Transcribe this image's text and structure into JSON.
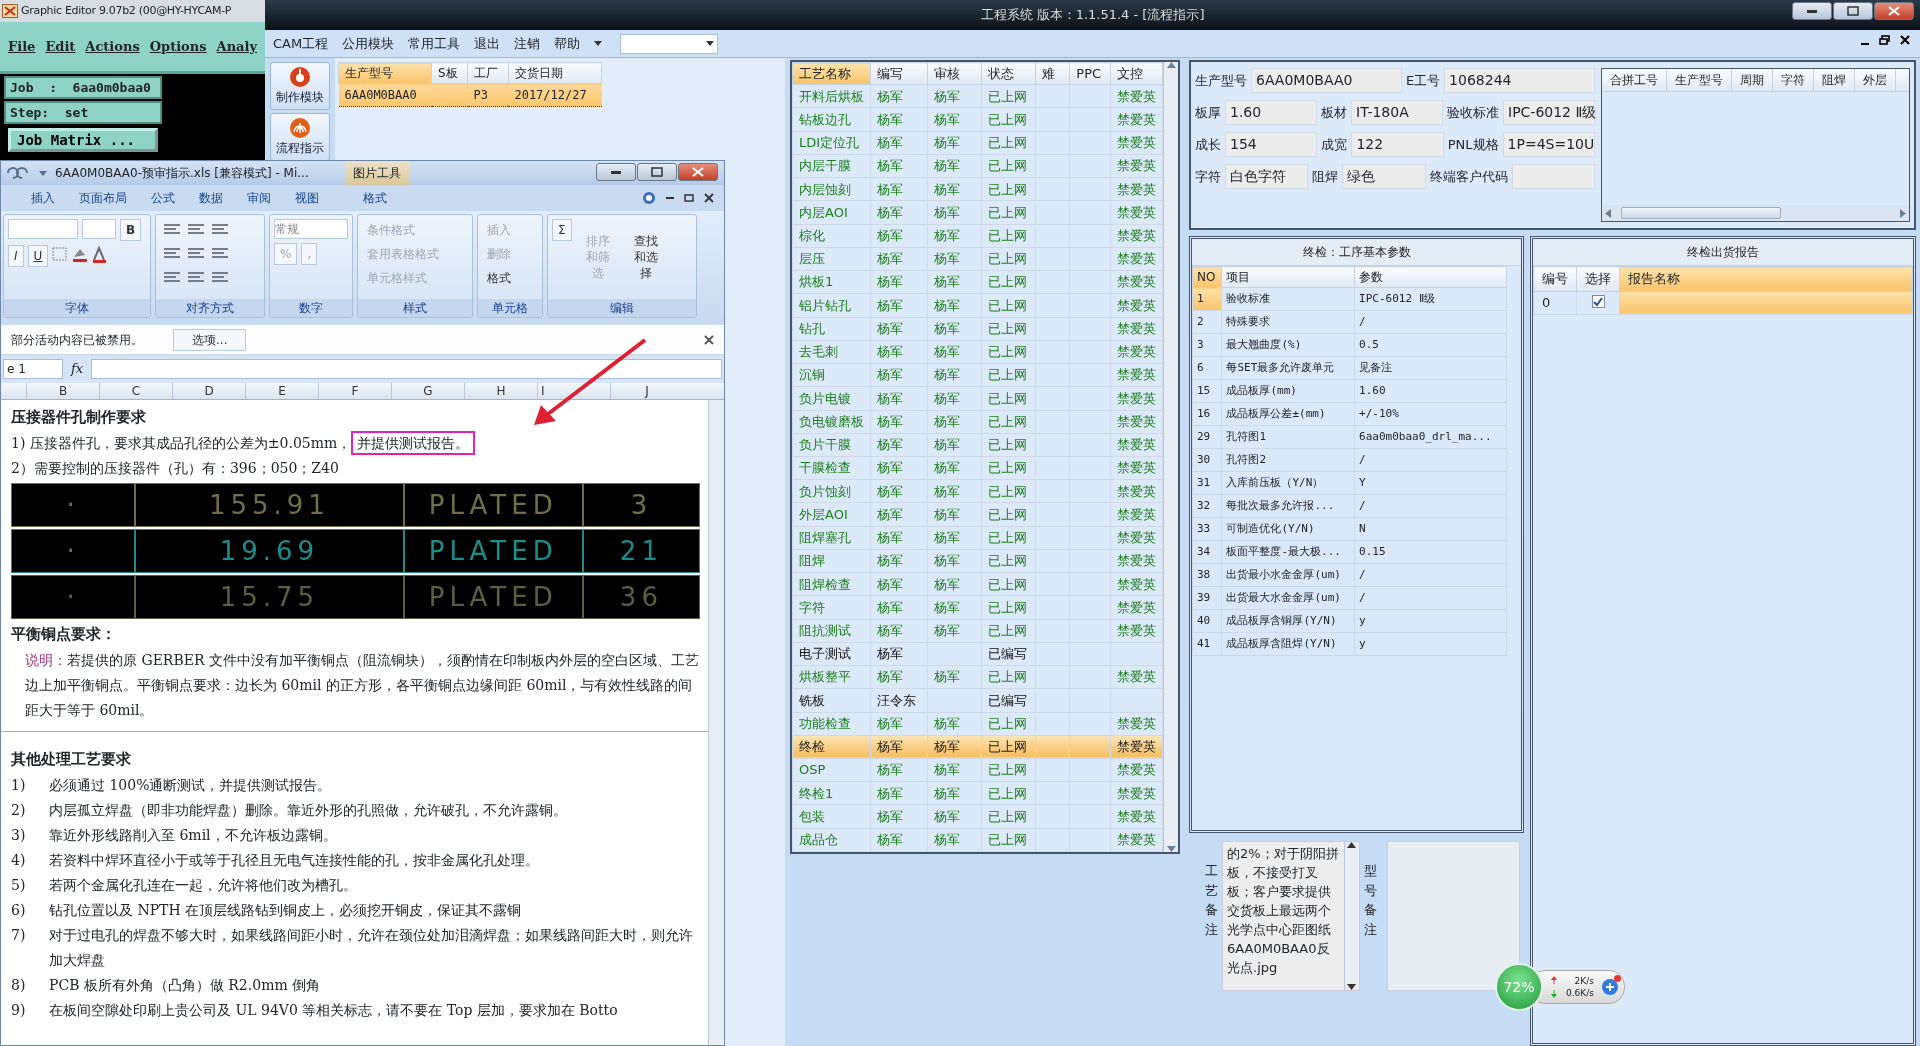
{
  "graphic_editor": {
    "title": "Graphic Editor 9.07b2 (00@HY-HYCAM-P",
    "menu": [
      "File",
      "Edit",
      "Actions",
      "Options",
      "Analy"
    ],
    "job": "Job  :  6aa0m0baa0",
    "step": "Step:  set",
    "button": "Job Matrix ..."
  },
  "cam": {
    "title": "工程系统   版本：1.1.51.4 - [流程指示]",
    "menu": [
      "CAM工程",
      "公用模块",
      "常用工具",
      "退出",
      "注销",
      "帮助"
    ],
    "tools": [
      "制作模块",
      "流程指示"
    ],
    "orders": {
      "columns": [
        "生产型号",
        "S板",
        "工厂",
        "交货日期"
      ],
      "rows": [
        {
          "cells": [
            "6AA0M0BAA0",
            "",
            "P3",
            "2017/12/27"
          ],
          "selected": true
        }
      ]
    },
    "process": {
      "columns": [
        "工艺名称",
        "编写",
        "审核",
        "状态",
        "难",
        "PPC",
        "文控"
      ],
      "rows": [
        {
          "name": "开料后烘板",
          "writer": "杨军",
          "reviewer": "杨军",
          "status": "已上网",
          "control": "禁爱英",
          "published": true,
          "selected": false
        },
        {
          "name": "钻板边孔",
          "writer": "杨军",
          "reviewer": "杨军",
          "status": "已上网",
          "control": "禁爱英",
          "published": true,
          "selected": false
        },
        {
          "name": "LDI定位孔",
          "writer": "杨军",
          "reviewer": "杨军",
          "status": "已上网",
          "control": "禁爱英",
          "published": true,
          "selected": false
        },
        {
          "name": "内层干膜",
          "writer": "杨军",
          "reviewer": "杨军",
          "status": "已上网",
          "control": "禁爱英",
          "published": true,
          "selected": false
        },
        {
          "name": "内层蚀刻",
          "writer": "杨军",
          "reviewer": "杨军",
          "status": "已上网",
          "control": "禁爱英",
          "published": true,
          "selected": false
        },
        {
          "name": "内层AOI",
          "writer": "杨军",
          "reviewer": "杨军",
          "status": "已上网",
          "control": "禁爱英",
          "published": true,
          "selected": false
        },
        {
          "name": "棕化",
          "writer": "杨军",
          "reviewer": "杨军",
          "status": "已上网",
          "control": "禁爱英",
          "published": true,
          "selected": false
        },
        {
          "name": "层压",
          "writer": "杨军",
          "reviewer": "杨军",
          "status": "已上网",
          "control": "禁爱英",
          "published": true,
          "selected": false
        },
        {
          "name": "烘板1",
          "writer": "杨军",
          "reviewer": "杨军",
          "status": "已上网",
          "control": "禁爱英",
          "published": true,
          "selected": false
        },
        {
          "name": "铝片钻孔",
          "writer": "杨军",
          "reviewer": "杨军",
          "status": "已上网",
          "control": "禁爱英",
          "published": true,
          "selected": false
        },
        {
          "name": "钻孔",
          "writer": "杨军",
          "reviewer": "杨军",
          "status": "已上网",
          "control": "禁爱英",
          "published": true,
          "selected": false
        },
        {
          "name": "去毛刺",
          "writer": "杨军",
          "reviewer": "杨军",
          "status": "已上网",
          "control": "禁爱英",
          "published": true,
          "selected": false
        },
        {
          "name": "沉铜",
          "writer": "杨军",
          "reviewer": "杨军",
          "status": "已上网",
          "control": "禁爱英",
          "published": true,
          "selected": false
        },
        {
          "name": "负片电镀",
          "writer": "杨军",
          "reviewer": "杨军",
          "status": "已上网",
          "control": "禁爱英",
          "published": true,
          "selected": false
        },
        {
          "name": "负电镀磨板",
          "writer": "杨军",
          "reviewer": "杨军",
          "status": "已上网",
          "control": "禁爱英",
          "published": true,
          "selected": false
        },
        {
          "name": "负片干膜",
          "writer": "杨军",
          "reviewer": "杨军",
          "status": "已上网",
          "control": "禁爱英",
          "published": true,
          "selected": false
        },
        {
          "name": "干膜检查",
          "writer": "杨军",
          "reviewer": "杨军",
          "status": "已上网",
          "control": "禁爱英",
          "published": true,
          "selected": false
        },
        {
          "name": "负片蚀刻",
          "writer": "杨军",
          "reviewer": "杨军",
          "status": "已上网",
          "control": "禁爱英",
          "published": true,
          "selected": false
        },
        {
          "name": "外层AOI",
          "writer": "杨军",
          "reviewer": "杨军",
          "status": "已上网",
          "control": "禁爱英",
          "published": true,
          "selected": false
        },
        {
          "name": "阻焊塞孔",
          "writer": "杨军",
          "reviewer": "杨军",
          "status": "已上网",
          "control": "禁爱英",
          "published": true,
          "selected": false
        },
        {
          "name": "阻焊",
          "writer": "杨军",
          "reviewer": "杨军",
          "status": "已上网",
          "control": "禁爱英",
          "published": true,
          "selected": false
        },
        {
          "name": "阻焊检查",
          "writer": "杨军",
          "reviewer": "杨军",
          "status": "已上网",
          "control": "禁爱英",
          "published": true,
          "selected": false
        },
        {
          "name": "字符",
          "writer": "杨军",
          "reviewer": "杨军",
          "status": "已上网",
          "control": "禁爱英",
          "published": true,
          "selected": false
        },
        {
          "name": "阻抗测试",
          "writer": "杨军",
          "reviewer": "杨军",
          "status": "已上网",
          "control": "禁爱英",
          "published": true,
          "selected": false
        },
        {
          "name": "电子测试",
          "writer": "杨军",
          "status": "已编写",
          "published": false,
          "selected": false
        },
        {
          "name": "烘板整平",
          "writer": "杨军",
          "reviewer": "杨军",
          "status": "已上网",
          "control": "禁爱英",
          "published": true,
          "selected": false
        },
        {
          "name": "铣板",
          "writer": "汪令东",
          "status": "已编写",
          "published": false,
          "selected": false
        },
        {
          "name": "功能检查",
          "writer": "杨军",
          "reviewer": "杨军",
          "status": "已上网",
          "control": "禁爱英",
          "published": true,
          "selected": false
        },
        {
          "name": "终检",
          "writer": "杨军",
          "reviewer": "杨军",
          "status": "已上网",
          "control": "禁爱英",
          "published": true,
          "selected": true
        },
        {
          "name": "OSP",
          "writer": "杨军",
          "reviewer": "杨军",
          "status": "已上网",
          "control": "禁爱英",
          "published": true,
          "selected": false
        },
        {
          "name": "终检1",
          "writer": "杨军",
          "reviewer": "杨军",
          "status": "已上网",
          "control": "禁爱英",
          "published": true,
          "selected": false
        },
        {
          "name": "包装",
          "writer": "杨军",
          "reviewer": "杨军",
          "status": "已上网",
          "control": "禁爱英",
          "published": true,
          "selected": false
        },
        {
          "name": "成品仓",
          "writer": "杨军",
          "reviewer": "杨军",
          "status": "已上网",
          "control": "禁爱英",
          "published": true,
          "selected": false
        }
      ]
    },
    "info": [
      [
        {
          "label": "生产型号",
          "value": "6AA0M0BAA0"
        },
        {
          "label": "E工号",
          "value": "1068244"
        }
      ],
      [
        {
          "label": "板厚",
          "value": "1.60"
        },
        {
          "label": "板材",
          "value": "IT-180A"
        },
        {
          "label": "验收标准",
          "value": "IPC-6012 Ⅱ级"
        }
      ],
      [
        {
          "label": "成长",
          "value": "154"
        },
        {
          "label": "成宽",
          "value": "122"
        },
        {
          "label": "PNL规格",
          "value": "1P=4S=10U"
        }
      ],
      [
        {
          "label": "字符",
          "value": "白色字符"
        },
        {
          "label": "阻焊",
          "value": "绿色"
        },
        {
          "label": "终端客户代码"
        }
      ]
    ],
    "merge_table": {
      "columns": [
        "合拼工号",
        "生产型号",
        "周期",
        "字符",
        "阻焊",
        "外层"
      ]
    },
    "params": {
      "title": "终检：工序基本参数",
      "columns": [
        "NO",
        "项目",
        "参数"
      ],
      "rows": [
        {
          "no": "1",
          "item": "验收标准",
          "value": "IPC-6012 Ⅱ级",
          "selected": true
        },
        {
          "no": "2",
          "item": "特殊要求",
          "value": "/",
          "selected": false
        },
        {
          "no": "3",
          "item": "最大翘曲度(%)",
          "value": "0.5",
          "selected": false
        },
        {
          "no": "6",
          "item": "每SET最多允许废单元",
          "value": "见备注",
          "selected": false
        },
        {
          "no": "15",
          "item": "成品板厚(mm)",
          "value": "1.60",
          "selected": false
        },
        {
          "no": "16",
          "item": "成品板厚公差±(mm)",
          "value": "+/-10%",
          "selected": false
        },
        {
          "no": "29",
          "item": "孔符图1",
          "value": "6aa0m0baa0_drl_ma...",
          "selected": false
        },
        {
          "no": "30",
          "item": "孔符图2",
          "value": "/",
          "selected": false
        },
        {
          "no": "31",
          "item": "入库前压板（Y/N）",
          "value": "Y",
          "selected": false
        },
        {
          "no": "32",
          "item": "每批次最多允许报...",
          "value": "/",
          "selected": false
        },
        {
          "no": "33",
          "item": "可制造优化(Y/N)",
          "value": "N",
          "selected": false
        },
        {
          "no": "34",
          "item": "板面平整度-最大极...",
          "value": "0.15",
          "selected": false
        },
        {
          "no": "38",
          "item": "出货最小水金金厚(um)",
          "value": "/",
          "selected": false
        },
        {
          "no": "39",
          "item": "出货最大水金金厚(um)",
          "value": "/",
          "selected": false
        },
        {
          "no": "40",
          "item": "成品板厚含铜厚(Y/N)",
          "value": "y",
          "selected": false
        },
        {
          "no": "41",
          "item": "成品板厚含阻焊(Y/N)",
          "value": "y",
          "selected": false
        }
      ]
    },
    "reports": {
      "title": "终检出货报告",
      "columns": [
        "编号",
        "选择",
        "报告名称"
      ],
      "rows": [
        {
          "no": "0",
          "checked": true,
          "selected": true
        }
      ]
    },
    "notes": {
      "label": "工艺备注",
      "text": "的2%；对于阴阳拼板，不接受打叉板；客户要求提供交货板上最远两个光学点中心距图纸6AA0M0BAA0反光点.jpg",
      "label2": "型号备注"
    }
  },
  "excel": {
    "title": "6AA0M0BAA0-预审指示.xls  [兼容模式]  -  Mi...",
    "context_tab": "图片工具",
    "tabs": [
      "插入",
      "页面布局",
      "公式",
      "数据",
      "审阅",
      "视图",
      "格式"
    ],
    "ribbon": [
      {
        "label": "字体",
        "kind": "font",
        "buttons": [
          "B",
          "I",
          "U"
        ]
      },
      {
        "label": "对齐方式",
        "kind": "align"
      },
      {
        "label": "数字",
        "kind": "number",
        "format": "常规",
        "buttons": [
          "%",
          ","
        ]
      },
      {
        "label": "样式",
        "kind": "list",
        "items": [
          {
            "label": "条件格式",
            "disabled": true
          },
          {
            "label": "套用表格格式",
            "disabled": true
          },
          {
            "label": "单元格样式",
            "disabled": true
          }
        ]
      },
      {
        "label": "单元格",
        "kind": "list",
        "items": [
          {
            "label": "插入",
            "disabled": true
          },
          {
            "label": "删除",
            "disabled": true
          },
          {
            "label": "格式",
            "disabled": false
          }
        ]
      },
      {
        "label": "编辑",
        "kind": "edit",
        "symbol": "Σ",
        "items": [
          {
            "label": "排序和筛选",
            "disabled": true
          },
          {
            "label": "查找和选择",
            "disabled": false
          }
        ]
      }
    ],
    "message": "部分活动内容已被禁用。",
    "options_button": "选项...",
    "name_box": "e 1",
    "fx": "fx",
    "columns": [
      "B",
      "C",
      "D",
      "E",
      "F",
      "G",
      "H",
      "I",
      "J"
    ],
    "doc": {
      "heading1": "压接器件孔制作要求",
      "line1": "1) 压接器件孔，要求其成品孔径的公差为±0.05mm，",
      "highlight": "并提供测试报告。",
      "line2": "2）需要控制的压接器件（孔）有：396；050；Z40",
      "drill_rows": [
        {
          "cells": [
            "·",
            "155.91",
            "PLATED",
            "3"
          ],
          "color": "#707048"
        },
        {
          "cells": [
            "·",
            "19.69",
            "PLATED",
            "21"
          ],
          "color": "#1f8c8c"
        },
        {
          "cells": [
            "·",
            "15.75",
            "PLATED",
            "36"
          ],
          "color": "#5e5e40"
        }
      ],
      "heading2": "平衡铜点要求：",
      "note_label": "说明：",
      "note_text": "若提供的原 GERBER 文件中没有加平衡铜点（阻流铜块），须酌情在印制板内外层的空白区域、工艺边上加平衡铜点。平衡铜点要求：边长为 60mil 的正方形，各平衡铜点边缘间距 60mil，与有效性线路的间距大于等于 60mil。",
      "heading3": "其他处理工艺要求",
      "items": [
        {
          "num": "1)",
          "text": "必须通过 100%通断测试，并提供测试报告。"
        },
        {
          "num": "2)",
          "text": "内层孤立焊盘（即非功能焊盘）删除。靠近外形的孔照做，允许破孔，不允许露铜。"
        },
        {
          "num": "3)",
          "text": "靠近外形线路削入至 6mil，不允许板边露铜。"
        },
        {
          "num": "4)",
          "text": "若资料中焊环直径小于或等于孔径且无电气连接性能的孔，按非金属化孔处理。"
        },
        {
          "num": "5)",
          "text": "若两个金属化孔连在一起，允许将他们改为槽孔。"
        },
        {
          "num": "6)",
          "text": "钻孔位置以及 NPTH 在顶层线路钻到铜皮上，必须挖开铜皮，保证其不露铜"
        },
        {
          "num": "7)",
          "text": "对于过电孔的焊盘不够大时，如果线路间距小时，允许在颈位处加泪滴焊盘；如果线路间距大时，则允许加大焊盘"
        },
        {
          "num": "8)",
          "text": "PCB 板所有外角（凸角）做 R2.0mm 倒角"
        },
        {
          "num": "9)",
          "text": "在板间空隙处印刷上贵公司及 UL 94V0 等相关标志，请不要在 Top 层加，要求加在 Botto"
        }
      ]
    }
  },
  "net_monitor": {
    "percent": "72%",
    "up": "2K/s",
    "down": "0.6K/s"
  }
}
